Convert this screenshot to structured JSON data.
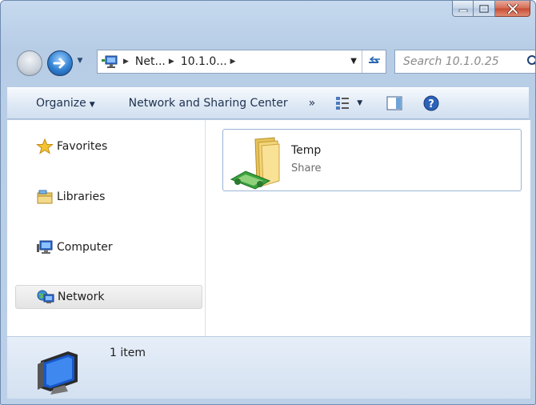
{
  "window": {
    "caption_buttons": [
      "minimize",
      "maximize",
      "close"
    ]
  },
  "navigation": {
    "breadcrumbs": [
      "Net...",
      "10.1.0..."
    ],
    "search_placeholder": "Search 10.1.0.25"
  },
  "toolbar": {
    "organize_label": "Organize",
    "network_sharing_label": "Network and Sharing Center",
    "more_label": "»"
  },
  "nav_pane": {
    "items": [
      {
        "label": "Favorites",
        "icon": "star-icon"
      },
      {
        "label": "Libraries",
        "icon": "libraries-icon"
      },
      {
        "label": "Computer",
        "icon": "computer-icon"
      },
      {
        "label": "Network",
        "icon": "network-icon",
        "selected": true
      }
    ]
  },
  "content": {
    "items": [
      {
        "name": "Temp",
        "type": "Share",
        "icon": "shared-folder-icon"
      }
    ]
  },
  "details": {
    "count_text": "1 item"
  },
  "colors": {
    "window_frame": "#bcd0e8",
    "accent_blue": "#2f7fd0",
    "close_red": "#c74b33"
  }
}
